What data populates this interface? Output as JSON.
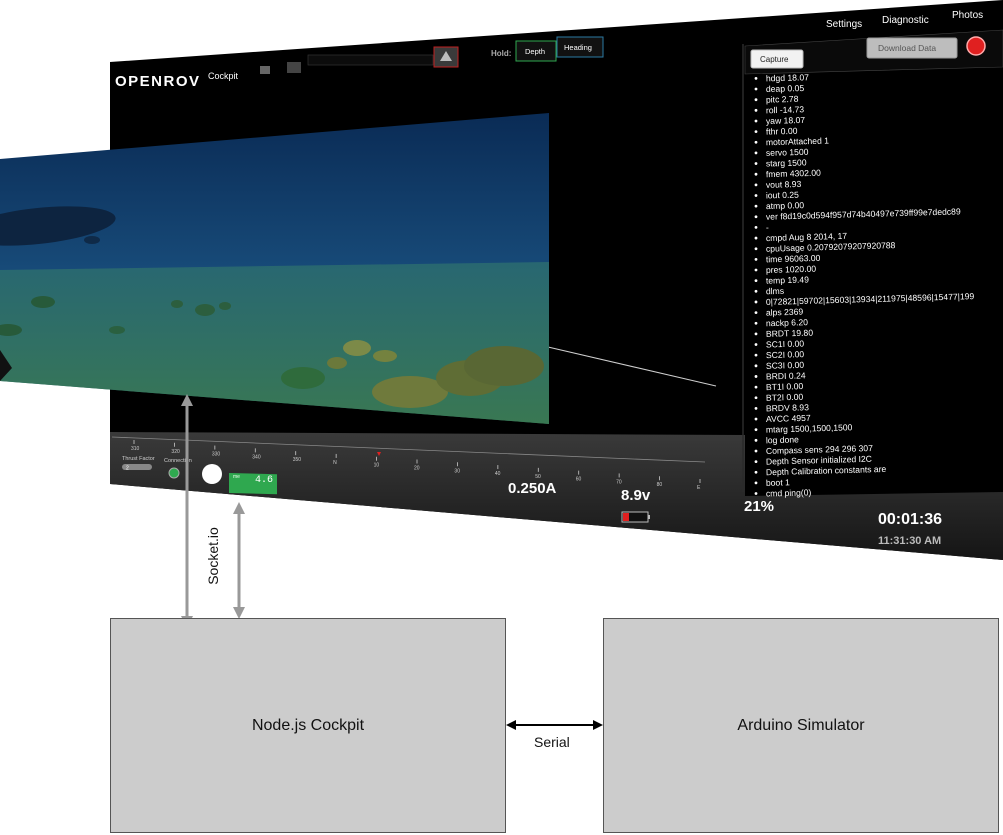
{
  "cockpit": {
    "logo_text": "OPENROV",
    "logo_sub": "Cockpit",
    "nav": [
      "Settings",
      "Diagnostic",
      "Photos"
    ],
    "hold_label": "Hold:",
    "hold_buttons": [
      "Depth",
      "Heading"
    ],
    "capture_label": "Capture",
    "download_label": "Download Data",
    "telemetry": [
      "hdgd 18.07",
      "deap 0.05",
      "pitc 2.78",
      "roll -14.73",
      "yaw 18.07",
      "fthr 0.00",
      "motorAttached 1",
      "servo 1500",
      "starg 1500",
      "fmem 4302.00",
      "vout 8.93",
      "iout 0.25",
      "atmp 0.00",
      "ver f8d19c0d594f957d74b40497e739ff99e7dedc89",
      "-",
      "cmpd Aug 8 2014, 17",
      "cpuUsage 0.20792079207920788",
      "time 96063.00",
      "pres 1020.00",
      "temp 19.49",
      "dlms",
      "0|72821|59702|15603|13934|211975|48596|15477|199",
      "alps 2369",
      "nackp 6.20",
      "BRDT 19.80",
      "SC1I 0.00",
      "SC2I 0.00",
      "SC3I 0.00",
      "BRDI 0.24",
      "BT1I 0.00",
      "BT2I 0.00",
      "BRDV 8.93",
      "AVCC 4957",
      "mtarg 1500,1500,1500",
      "log done",
      "Compass sens 294 296 307",
      "Depth Sensor initialized I2C",
      "Depth Calibration constants are",
      "boot 1",
      "cmd ping(0)"
    ],
    "thrust_label": "Thrust Factor",
    "thrust_value": "2",
    "connection_label": "Connection",
    "depth_unit": "me",
    "depth_value": "4.6",
    "compass_ticks": [
      "310",
      "320",
      "330",
      "340",
      "350",
      "N",
      "10",
      "20",
      "30",
      "40",
      "50",
      "60",
      "70",
      "80",
      "E"
    ],
    "current": "0.250A",
    "voltage": "8.9v",
    "cpu": "21%",
    "timer": "00:01:36",
    "clock": "11:31:30 AM",
    "colors": {
      "panel_bg": "#000000",
      "accent_green": "#2fa84f",
      "alert_red": "#e02020"
    }
  },
  "diagram": {
    "node_box": "Node.js Cockpit",
    "arduino_box": "Arduino Simulator",
    "serial_label": "Serial",
    "socketio_label": "Socket.io"
  }
}
